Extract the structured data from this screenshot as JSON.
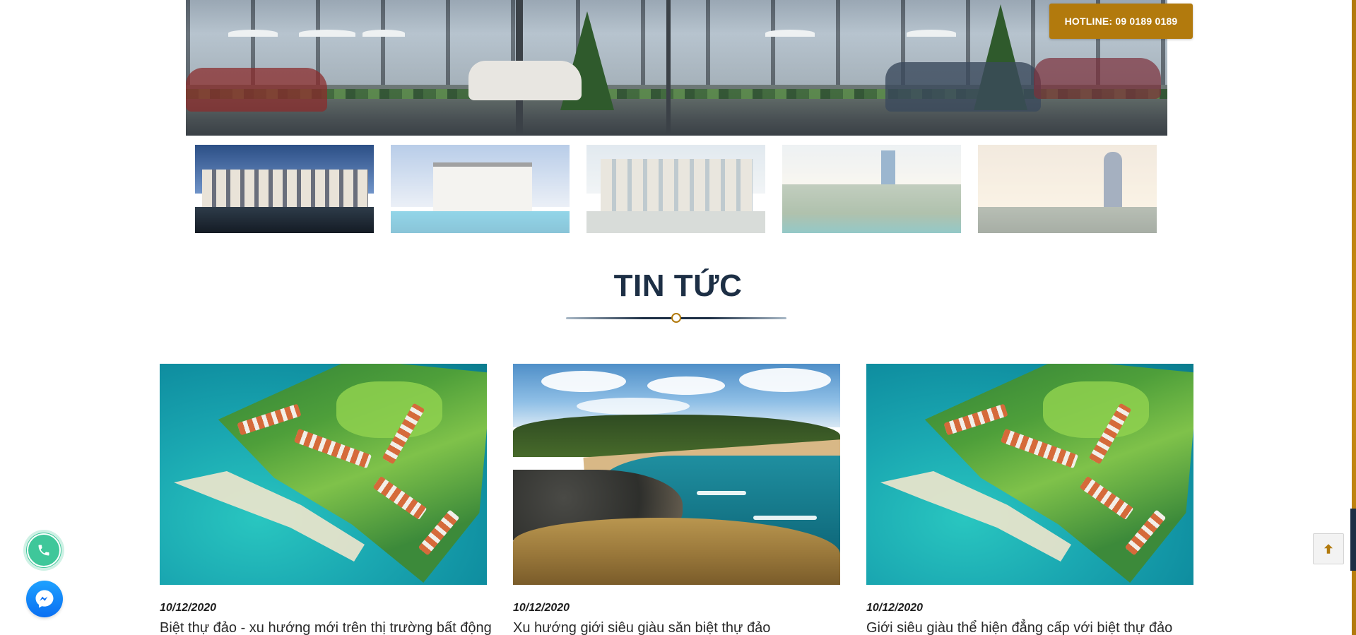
{
  "hero": {
    "hotline_label": "HOTLINE: 09 0189 0189"
  },
  "gallery": {
    "thumbnails": [
      {
        "name": "thumb-shophouse-night",
        "active": true
      },
      {
        "name": "thumb-villa-pool",
        "active": false
      },
      {
        "name": "thumb-shophouse-day",
        "active": false
      },
      {
        "name": "thumb-aerial-city",
        "active": false
      },
      {
        "name": "thumb-tower-sunset",
        "active": false
      }
    ]
  },
  "news_section": {
    "title": "TIN TỨC",
    "articles": [
      {
        "date": "10/12/2020",
        "title": "Biệt thự đảo - xu hướng mới trên thị trường bất động",
        "image": "island-aerial"
      },
      {
        "date": "10/12/2020",
        "title": "Xu hướng giới siêu giàu săn biệt thự đảo",
        "image": "coastal-beach"
      },
      {
        "date": "10/12/2020",
        "title": "Giới siêu giàu thể hiện đẳng cấp với biệt thự đảo",
        "image": "island-aerial"
      }
    ]
  },
  "floating": {
    "phone_icon": "phone-icon",
    "messenger_icon": "messenger-icon",
    "back_to_top_icon": "arrow-up-icon"
  },
  "colors": {
    "accent_gold": "#b27a0d",
    "title_navy": "#1d2f45",
    "phone_green": "#3fc79a",
    "messenger_blue": "#0a6ff2"
  }
}
